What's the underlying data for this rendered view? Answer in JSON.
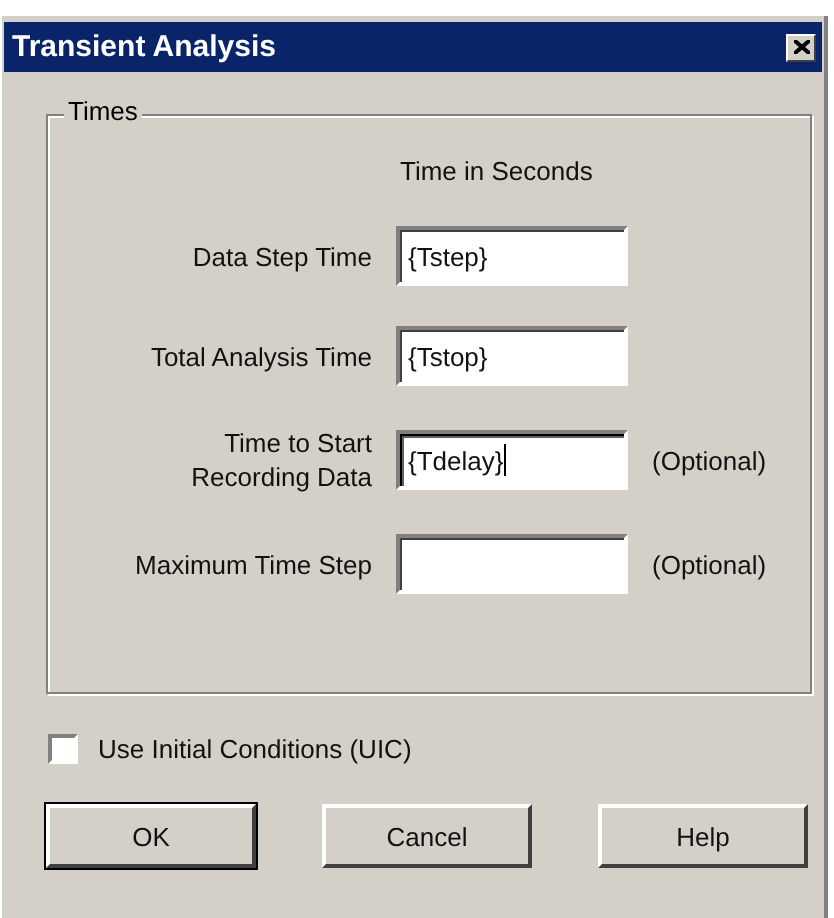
{
  "window": {
    "title": "Transient Analysis"
  },
  "group": {
    "title": "Times",
    "column_heading": "Time in Seconds",
    "fields": [
      {
        "label": "Data Step Time",
        "value": "{Tstep}",
        "focused": false
      },
      {
        "label": "Total Analysis Time",
        "value": "{Tstop}",
        "focused": false
      },
      {
        "label": "Time to Start\nRecording Data",
        "value": "{Tdelay}",
        "focused": true,
        "note": "(Optional)"
      },
      {
        "label": "Maximum Time Step",
        "focused": false,
        "note": "(Optional)"
      }
    ]
  },
  "checkbox": {
    "label": "Use Initial Conditions (UIC)",
    "checked": false
  },
  "buttons": [
    {
      "label": "OK",
      "default": true
    },
    {
      "label": "Cancel",
      "default": false
    },
    {
      "label": "Help",
      "default": false
    }
  ]
}
